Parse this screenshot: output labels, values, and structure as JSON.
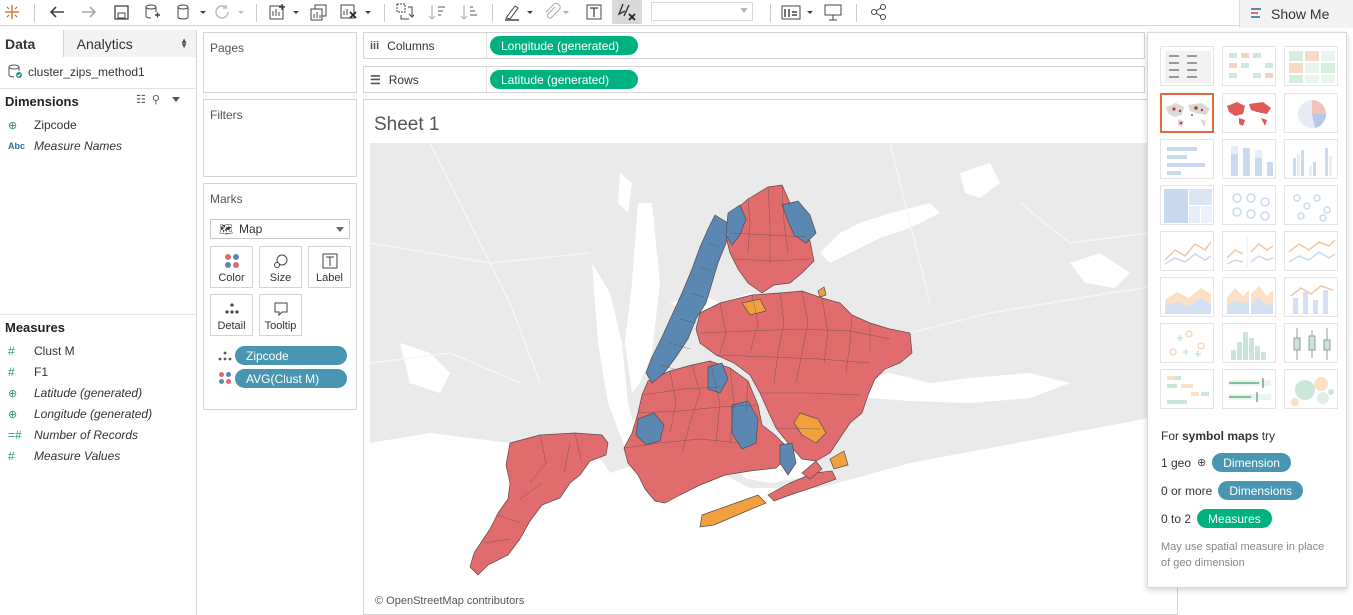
{
  "toolbar": {
    "show_me_label": "Show Me"
  },
  "data_pane": {
    "tabs": [
      {
        "label": "Data"
      },
      {
        "label": "Analytics"
      }
    ],
    "data_source": "cluster_zips_method1",
    "dimensions_header": "Dimensions",
    "dimensions": [
      {
        "label": "Zipcode",
        "icon": "globe-icon"
      },
      {
        "label": "Measure Names",
        "icon": "abc-icon"
      }
    ],
    "measures_header": "Measures",
    "measures": [
      {
        "label": "Clust M",
        "icon": "hash-icon"
      },
      {
        "label": "F1",
        "icon": "hash-icon"
      },
      {
        "label": "Latitude (generated)",
        "icon": "globe-icon"
      },
      {
        "label": "Longitude (generated)",
        "icon": "globe-icon"
      },
      {
        "label": "Number of Records",
        "icon": "hash-icon"
      },
      {
        "label": "Measure Values",
        "icon": "hash-icon"
      }
    ]
  },
  "cards": {
    "pages": "Pages",
    "filters": "Filters",
    "marks": "Marks",
    "mark_type": "Map",
    "mark_buttons": [
      "Color",
      "Size",
      "Label",
      "Detail",
      "Tooltip"
    ],
    "mark_fields": [
      {
        "label": "Zipcode"
      },
      {
        "label": "AVG(Clust M)"
      }
    ]
  },
  "shelves": {
    "columns_label": "Columns",
    "columns_pill": "Longitude (generated)",
    "rows_label": "Rows",
    "rows_pill": "Latitude (generated)"
  },
  "sheet": {
    "title": "Sheet 1",
    "attribution": "© OpenStreetMap contributors",
    "colors": {
      "cluster_red": "#e06c6e",
      "cluster_blue": "#5b87b3",
      "cluster_orange": "#f0a03c",
      "water": "#ffffff",
      "land": "#eaeaea"
    }
  },
  "show_me": {
    "hint_prefix": "For",
    "hint_bold": "symbol maps",
    "hint_suffix": "try",
    "req1_count": "1 geo",
    "req1_pill": "Dimension",
    "req2_count": "0 or more",
    "req2_pill": "Dimensions",
    "req3_count": "0 to 2",
    "req3_pill": "Measures",
    "note": "May use spatial measure in place of geo dimension",
    "selected_chart": "symbol map"
  }
}
